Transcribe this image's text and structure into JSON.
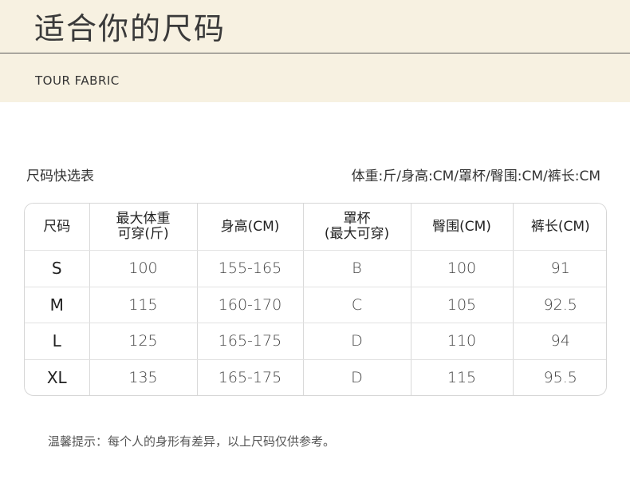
{
  "header": {
    "title": "适合你的尺码",
    "subtitle": "TOUR FABRIC"
  },
  "quick_label": "尺码快选表",
  "units_label": "体重:斤/身高:CM/罩杯/臀围:CM/裤长:CM",
  "table": {
    "headers": [
      [
        "尺码"
      ],
      [
        "最大体重",
        "可穿(斤)"
      ],
      [
        "身高(CM)"
      ],
      [
        "罩杯",
        "(最大可穿)"
      ],
      [
        "臀围(CM)"
      ],
      [
        "裤长(CM)"
      ]
    ],
    "rows": [
      [
        "S",
        "100",
        "155-165",
        "B",
        "100",
        "91"
      ],
      [
        "M",
        "115",
        "160-170",
        "C",
        "105",
        "92.5"
      ],
      [
        "L",
        "125",
        "165-175",
        "D",
        "110",
        "94"
      ],
      [
        "XL",
        "135",
        "165-175",
        "D",
        "115",
        "95.5"
      ]
    ]
  },
  "tip": "温馨提示：每个人的身形有差异，以上尺码仅供参考。"
}
